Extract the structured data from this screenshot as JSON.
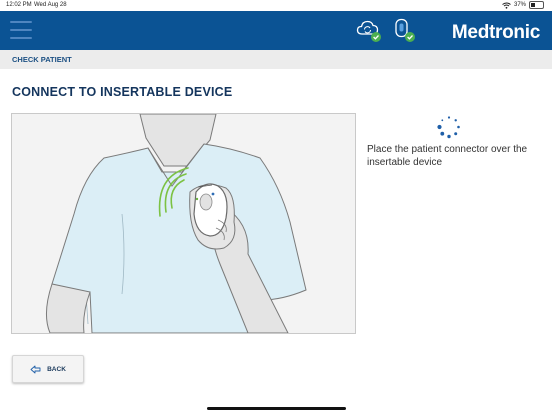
{
  "status_bar": {
    "time": "12:02 PM",
    "date": "Wed Aug 28",
    "battery_percent_text": "37%",
    "battery_level": 0.37
  },
  "header": {
    "brand": "Medtronic",
    "icons": [
      "menu-icon",
      "cloud-sync-check-icon",
      "device-connected-check-icon"
    ],
    "background_color": "#0b5394",
    "status_ok_color": "#4caf50"
  },
  "breadcrumb": "CHECK PATIENT",
  "page_title": "CONNECT TO INSERTABLE DEVICE",
  "instruction": "Place the patient connector over the insertable device",
  "back_button": {
    "label": "BACK",
    "icon": "back-arrow-icon"
  },
  "accent_colors": {
    "signal_waves": "#7cc243",
    "spinner": "#1f5fa8"
  }
}
